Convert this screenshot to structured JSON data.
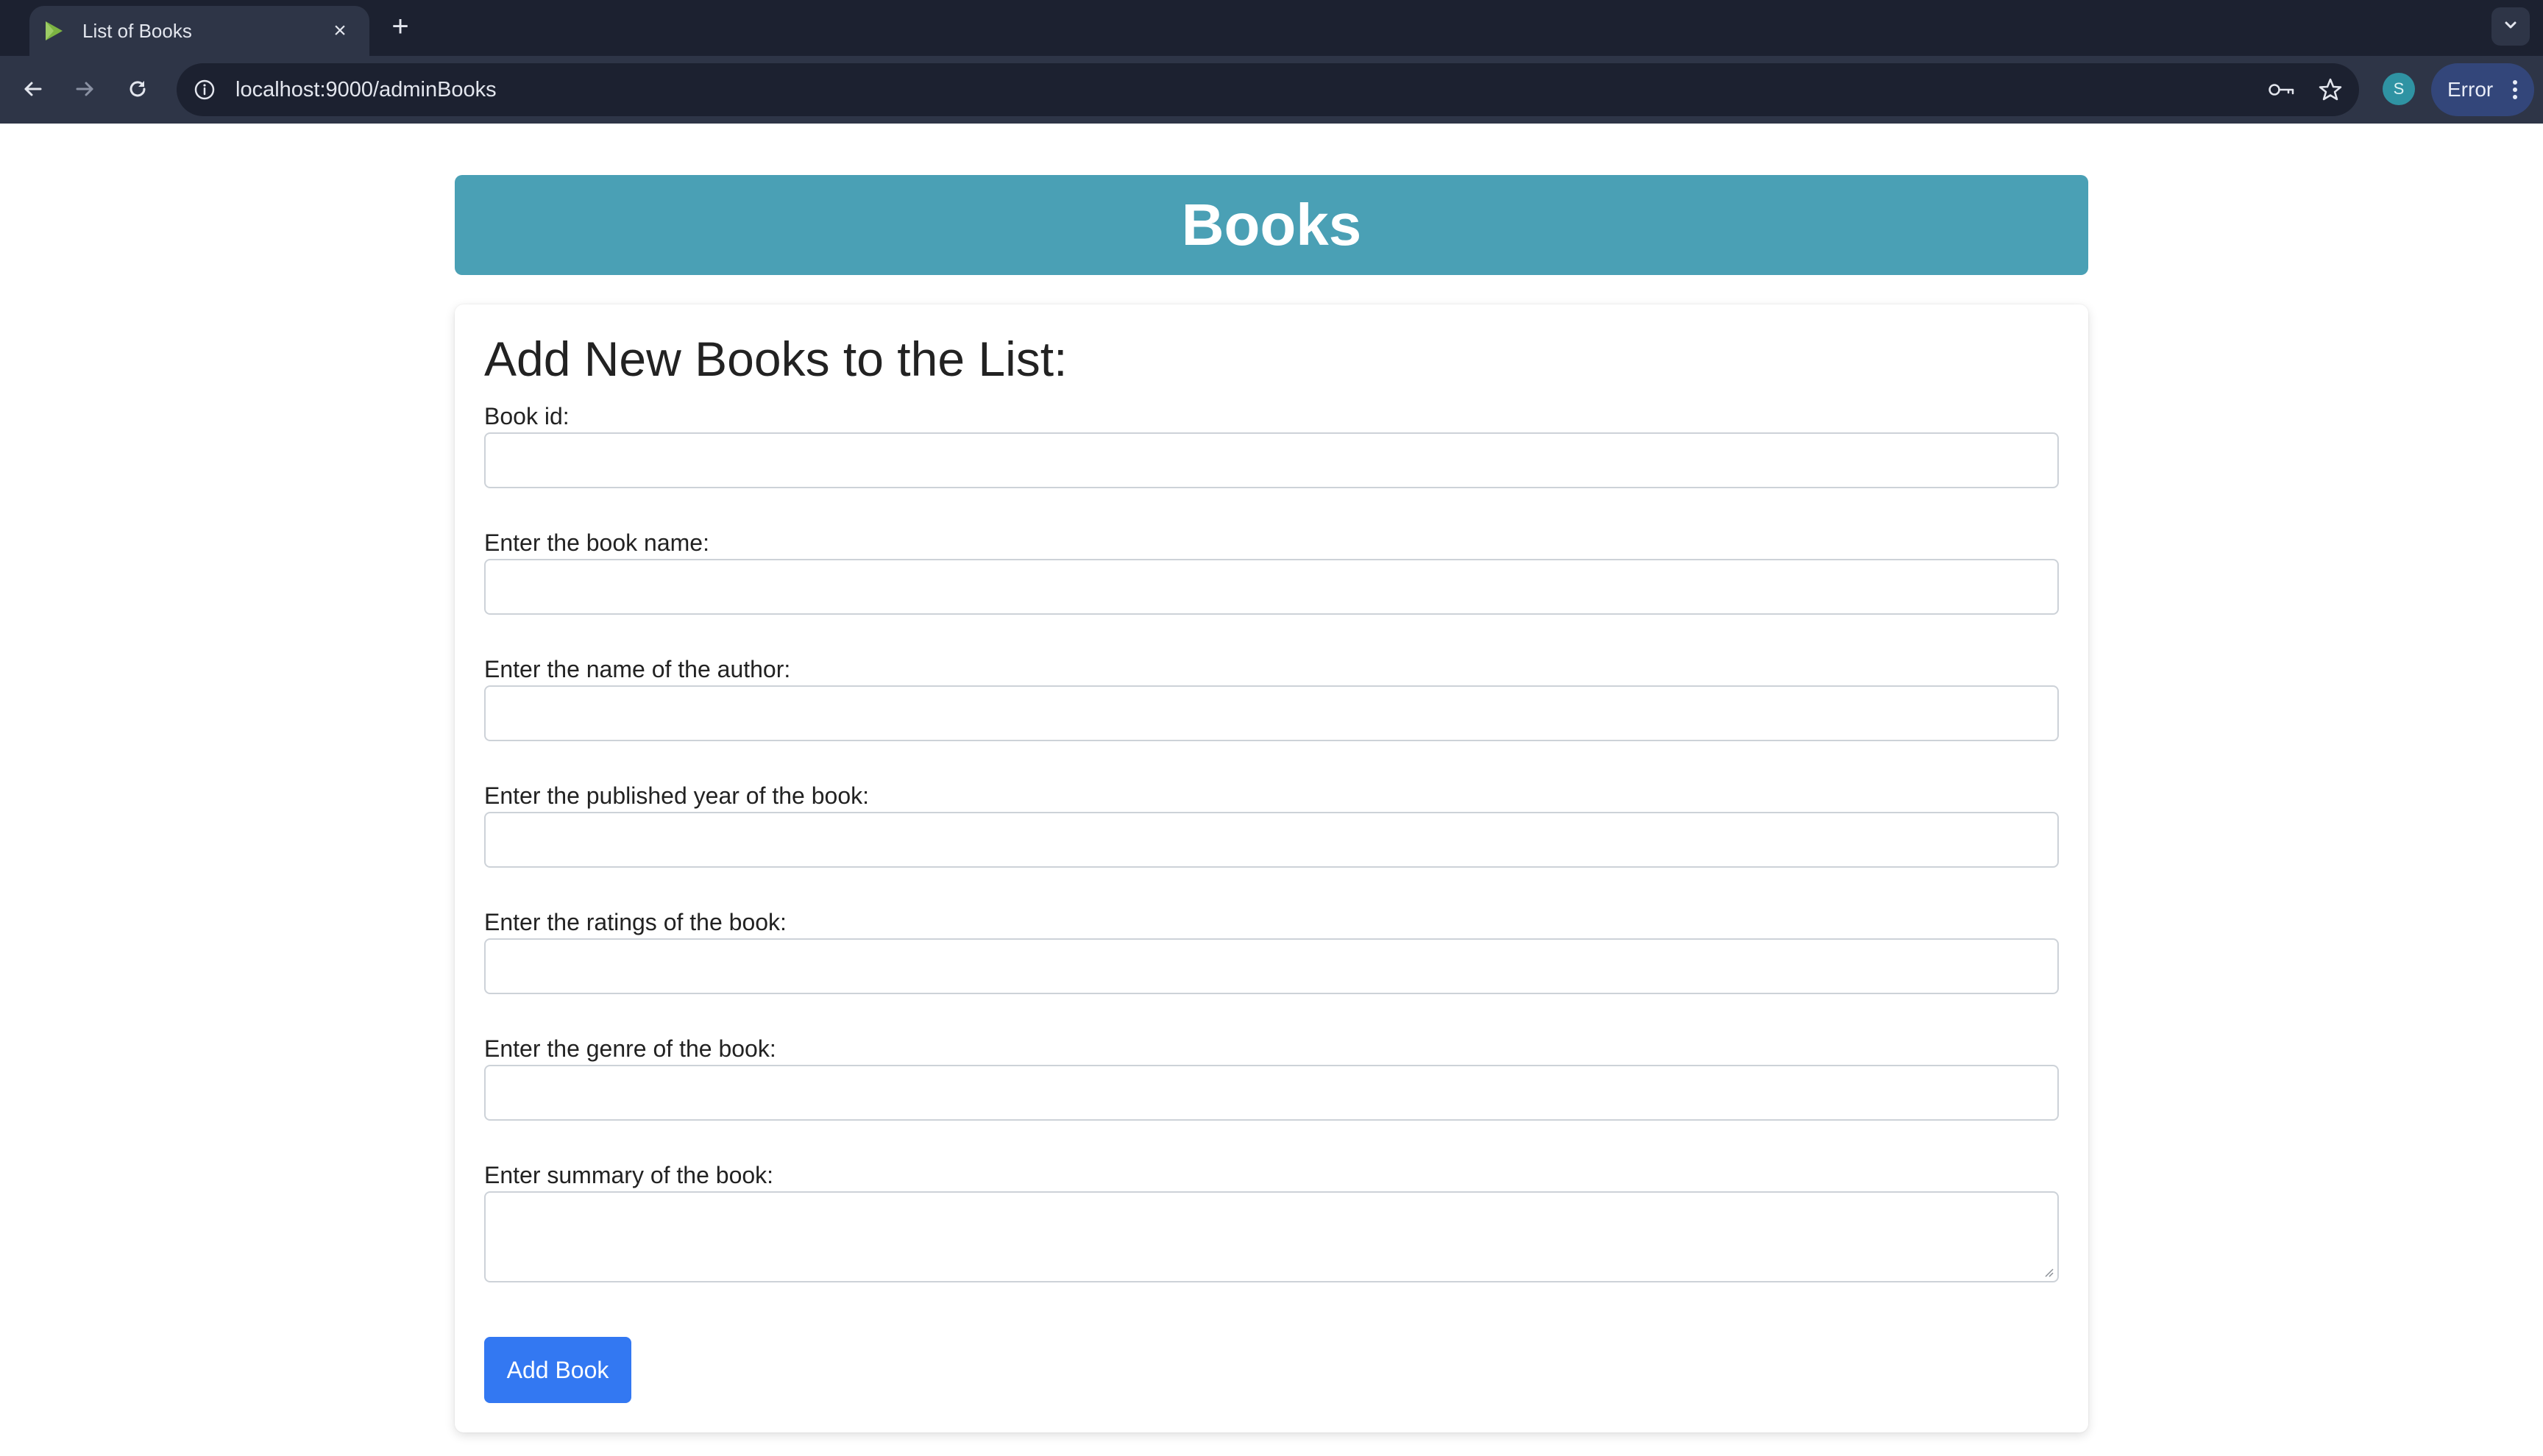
{
  "browser": {
    "tab_title": "List of Books",
    "tab_close": "×",
    "new_tab": "+",
    "url": "localhost:9000/adminBooks",
    "profile_initial": "S",
    "error_label": "Error"
  },
  "page": {
    "banner_title": "Books",
    "form_heading": "Add New Books to the List:",
    "fields": [
      {
        "label": "Book id:"
      },
      {
        "label": "Enter the book name:"
      },
      {
        "label": "Enter the name of the author:"
      },
      {
        "label": "Enter the published year of the book:"
      },
      {
        "label": "Enter the ratings of the book:"
      },
      {
        "label": "Enter the genre of the book:"
      },
      {
        "label": "Enter summary of the book:"
      }
    ],
    "submit_label": "Add Book"
  },
  "colors": {
    "banner": "#4aa0b5",
    "button": "#3378f2",
    "chrome_dark": "#1c2130",
    "chrome_toolbar": "#2e3547",
    "profile_avatar": "#2f93a3"
  },
  "icons": {
    "favicon": "play-triangle-icon",
    "back": "arrow-left-icon",
    "forward": "arrow-right-icon",
    "reload": "reload-icon",
    "site_info": "info-circle-icon",
    "passwords": "key-icon",
    "bookmark": "star-icon",
    "menu": "kebab-menu-icon",
    "tab_search": "chevron-down-icon"
  }
}
